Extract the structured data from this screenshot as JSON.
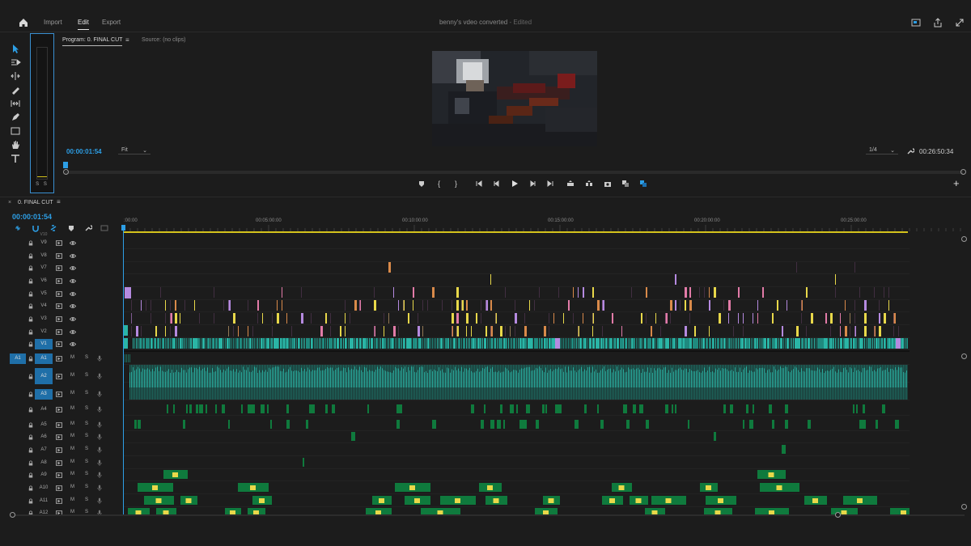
{
  "topbar": {
    "tabs": [
      "Import",
      "Edit",
      "Export"
    ],
    "active_tab": "Edit",
    "project_name": "benny's vdeo converted",
    "project_status": "- Edited"
  },
  "program_monitor": {
    "tab_label": "Program: 0. FINAL CUT",
    "source_label": "Source: (no clips)",
    "current_time": "00:00:01:54",
    "fit_value": "Fit",
    "resolution": "1/4",
    "duration": "00:26:50:34"
  },
  "meter": {
    "labels": "S S",
    "level_fraction": 0.07
  },
  "sequence": {
    "name": "0. FINAL CUT",
    "current_time": "00:00:01:54",
    "ruler_labels": [
      ":00:00",
      "00:05:00:00",
      "00:10:00:00",
      "00:15:00:00",
      "00:20:00:00",
      "00:25:00:00"
    ],
    "video_tracks": [
      "V10",
      "V9",
      "V8",
      "V7",
      "V6",
      "V5",
      "V4",
      "V3",
      "V2",
      "V1"
    ],
    "audio_tracks": [
      "A1",
      "A2",
      "A3",
      "A4",
      "A5",
      "A6",
      "A7",
      "A8",
      "A9",
      "A10",
      "A11",
      "A12"
    ],
    "source_patch_label": "A1",
    "mute_label": "M",
    "solo_label": "S"
  },
  "colors": {
    "accent": "#2d9fe6",
    "video_clip": "#2ab5a6",
    "audio_clip": "#0f7a3d",
    "clip_yellow": "#e8d84a",
    "clip_pink": "#e27ba8",
    "clip_purple": "#b58ae0",
    "work_area": "#d4c21c"
  },
  "icons": [
    "home-icon",
    "export-icon",
    "fullscreen-icon",
    "panel-icon",
    "selection-tool-icon",
    "track-select-icon",
    "ripple-edit-icon",
    "razor-icon",
    "slip-icon",
    "pen-icon",
    "rectangle-icon",
    "hand-icon",
    "type-icon",
    "marker-icon",
    "play-icon",
    "camera-icon",
    "wrench-icon",
    "lock-icon",
    "eye-icon",
    "mic-icon"
  ]
}
